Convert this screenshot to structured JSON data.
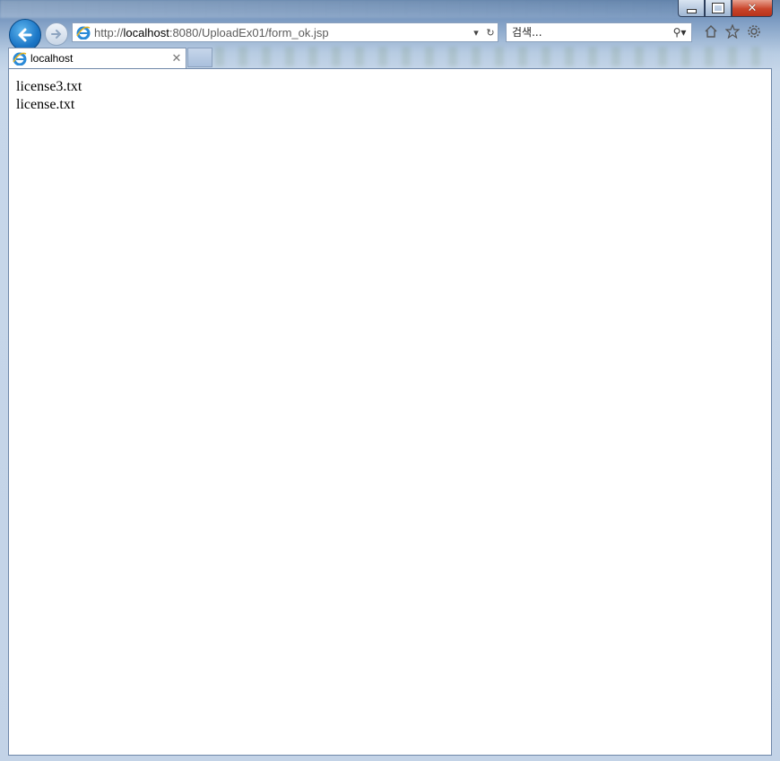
{
  "browser": {
    "address": {
      "url_prefix": "http://",
      "url_host": "localhost",
      "url_rest": ":8080/UploadEx01/form_ok.jsp"
    },
    "search": {
      "placeholder": "검색..."
    },
    "tab": {
      "label": "localhost"
    }
  },
  "page": {
    "files": [
      "license3.txt",
      "license.txt"
    ]
  },
  "colors": {
    "back_button": "#1b76c6",
    "close_button": "#c9452b"
  }
}
